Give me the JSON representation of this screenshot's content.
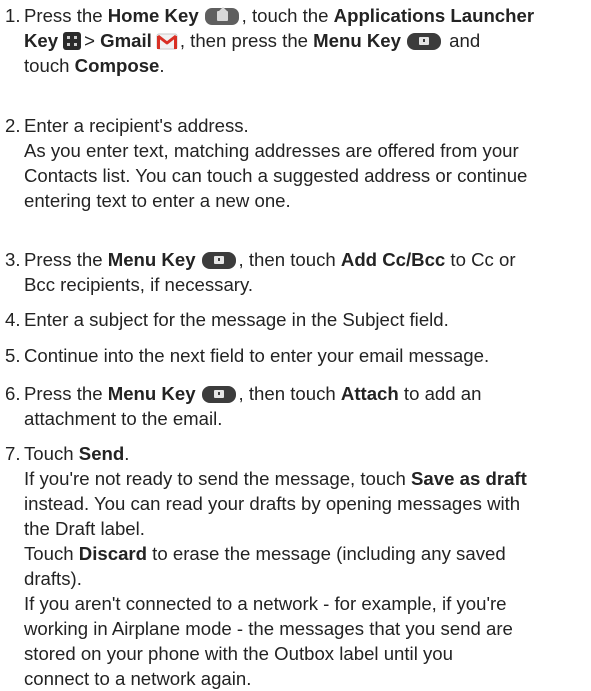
{
  "steps": [
    {
      "num": "1.",
      "lines": [
        [
          {
            "t": "Press the "
          },
          {
            "t": "Home Key",
            "b": true
          },
          {
            "icon": "home-key-icon"
          },
          {
            "t": ", touch the "
          },
          {
            "t": "Applications Launcher",
            "b": true
          }
        ],
        [
          {
            "t": "Key",
            "b": true
          },
          {
            "icon": "applications-launcher-icon"
          },
          {
            "t": "> "
          },
          {
            "t": "Gmail",
            "b": true
          },
          {
            "icon": "gmail-icon"
          },
          {
            "t": ", then press the "
          },
          {
            "t": "Menu Key",
            "b": true
          },
          {
            "icon": "menu-key-icon"
          },
          {
            "t": " and"
          }
        ],
        [
          {
            "t": "touch "
          },
          {
            "t": "Compose",
            "b": true
          },
          {
            "t": "."
          }
        ]
      ]
    },
    {
      "num": "2.",
      "lines": [
        [
          {
            "t": "Enter a recipient's address."
          }
        ],
        [
          {
            "t": "As you enter text, matching addresses are offered from your"
          }
        ],
        [
          {
            "t": "Contacts list. You can touch a suggested address or continue"
          }
        ],
        [
          {
            "t": "entering text to enter a new one."
          }
        ]
      ]
    },
    {
      "num": "3.",
      "lines": [
        [
          {
            "t": "Press the "
          },
          {
            "t": "Menu Key",
            "b": true
          },
          {
            "icon": "menu-key-icon"
          },
          {
            "t": ", then touch "
          },
          {
            "t": "Add Cc/Bcc",
            "b": true
          },
          {
            "t": " to Cc or"
          }
        ],
        [
          {
            "t": "Bcc recipients, if necessary."
          }
        ]
      ]
    },
    {
      "num": "4.",
      "lines": [
        [
          {
            "t": "Enter a subject for the message in the Subject field."
          }
        ]
      ]
    },
    {
      "num": "5.",
      "lines": [
        [
          {
            "t": "Continue into the next field to enter your email message."
          }
        ]
      ]
    },
    {
      "num": "6.",
      "lines": [
        [
          {
            "t": "Press the "
          },
          {
            "t": "Menu Key",
            "b": true
          },
          {
            "icon": "menu-key-icon"
          },
          {
            "t": ", then touch "
          },
          {
            "t": "Attach",
            "b": true
          },
          {
            "t": " to add an"
          }
        ],
        [
          {
            "t": "attachment to the email."
          }
        ]
      ]
    },
    {
      "num": "7.",
      "lines": [
        [
          {
            "t": "Touch "
          },
          {
            "t": "Send",
            "b": true
          },
          {
            "t": "."
          }
        ],
        [
          {
            "t": "If you're not ready to send the message, touch "
          },
          {
            "t": "Save as draft",
            "b": true
          }
        ],
        [
          {
            "t": "instead. You can read your drafts by opening messages with"
          }
        ],
        [
          {
            "t": "the Draft label."
          }
        ],
        [
          {
            "t": "Touch "
          },
          {
            "t": "Discard",
            "b": true
          },
          {
            "t": " to erase the message (including any saved"
          }
        ],
        [
          {
            "t": "drafts)."
          }
        ],
        [
          {
            "t": "If you aren't connected to a network - for example, if you're"
          }
        ],
        [
          {
            "t": "working in Airplane mode - the messages that you send are"
          }
        ],
        [
          {
            "t": "stored on your phone with the Outbox label until you"
          }
        ],
        [
          {
            "t": "connect to a network again."
          }
        ]
      ]
    }
  ],
  "colors": {
    "text": "#232323",
    "key_dark": "#3c3c3c",
    "home_key": "#5f5f5f",
    "gmail_red": "#d93025"
  }
}
